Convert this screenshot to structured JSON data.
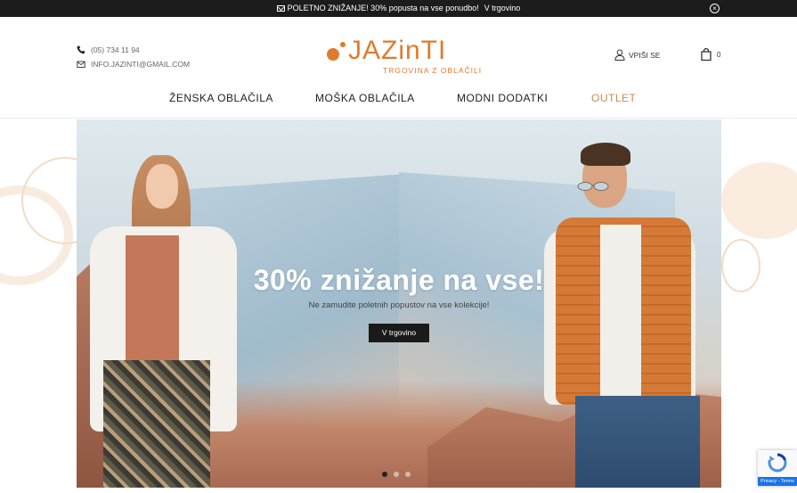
{
  "topbar": {
    "message": "POLETNO ZNIŽANJE! 30% popusta na vse ponudbo!",
    "link": "V trgovino",
    "close_symbol": "×"
  },
  "header": {
    "phone": "(05) 734 11 94",
    "email": "INFO.JAZINTI@GMAIL.COM",
    "logo_text": "JAZinTI",
    "logo_tagline": "TRGOVINA Z OBLAČILI",
    "login_label": "VPIŠI SE",
    "cart_count": "0"
  },
  "nav": {
    "items": [
      {
        "label": "ŽENSKA OBLAČILA"
      },
      {
        "label": "MOŠKA OBLAČILA"
      },
      {
        "label": "MODNI DODATKI"
      },
      {
        "label": "OUTLET"
      }
    ]
  },
  "hero": {
    "title": "30% znižanje na vse!",
    "subtitle": "Ne zamudite poletnih popustov na vse kolekcije!",
    "button": "V trgovino",
    "slides": 3,
    "active_slide": 1
  },
  "recaptcha": {
    "label": "Privacy - Terms"
  },
  "colors": {
    "accent": "#e07b2e",
    "outlet": "#d08a47",
    "topbar": "#1c1c1c",
    "button": "#1a1a1a"
  },
  "icons": [
    "mail-icon",
    "close-icon",
    "phone-icon",
    "envelope-icon",
    "user-icon",
    "shopping-bag-icon",
    "recaptcha-icon"
  ]
}
